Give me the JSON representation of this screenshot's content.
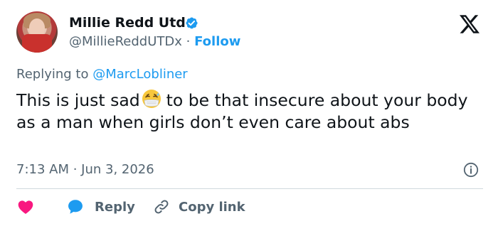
{
  "author": {
    "display_name": "Millie Redd Utd",
    "handle": "@MillieReddUTDx",
    "separator": " · ",
    "follow_label": "Follow"
  },
  "reply_context": {
    "prefix": "Replying to ",
    "mention": "@MarcLobliner"
  },
  "tweet": {
    "text_before_emoji": "This is just sad",
    "emoji": "face-with-medical-mask-and-sweat",
    "text_after_emoji": "to be that insecure about your body as a man when girls don’t even care about abs",
    "timestamp": "7:13 AM · Jun 3, 2026"
  },
  "actions": {
    "like_icon": "heart-icon",
    "reply_label": "Reply",
    "copy_label": "Copy link"
  },
  "icons": {
    "verified": "verified-badge-icon",
    "logo": "x-logo-icon",
    "info": "info-icon"
  },
  "colors": {
    "accent": "#1d9bf0",
    "heart": "#f91880",
    "text": "#0f1419",
    "secondary": "#536471"
  }
}
